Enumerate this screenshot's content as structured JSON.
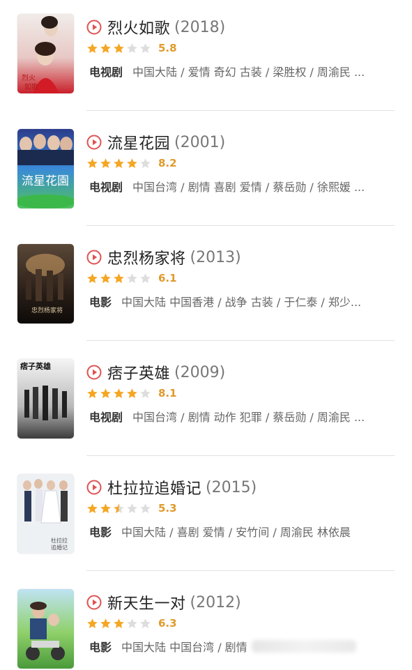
{
  "items": [
    {
      "title": "烈火如歌",
      "year": "(2018)",
      "rating": 5.8,
      "rating_text": "5.8",
      "type": "电视剧",
      "info": "中国大陆 / 爱情 奇幻 古装 / 梁胜权 / 周渝民 ..."
    },
    {
      "title": "流星花园",
      "year": "(2001)",
      "rating": 8.2,
      "rating_text": "8.2",
      "type": "电视剧",
      "info": "中国台湾 / 剧情 喜剧 爱情 / 蔡岳勋 / 徐熙媛 ..."
    },
    {
      "title": "忠烈杨家将",
      "year": "(2013)",
      "rating": 6.1,
      "rating_text": "6.1",
      "type": "电影",
      "info": "中国大陆 中国香港 / 战争 古装 / 于仁泰 / 郑少..."
    },
    {
      "title": "痞子英雄",
      "year": "(2009)",
      "rating": 8.1,
      "rating_text": "8.1",
      "type": "电视剧",
      "info": "中国台湾 / 剧情 动作 犯罪 / 蔡岳勋 / 周渝民 ..."
    },
    {
      "title": "杜拉拉追婚记",
      "year": "(2015)",
      "rating": 5.3,
      "rating_text": "5.3",
      "type": "电影",
      "info": "中国大陆 / 喜剧 爱情 / 安竹间 / 周渝民 林依晨"
    },
    {
      "title": "新天生一对",
      "year": "(2012)",
      "rating": 6.3,
      "rating_text": "6.3",
      "type": "电影",
      "info": "中国大陆 中国台湾 / 剧情"
    }
  ],
  "colors": {
    "play": "#e05252",
    "star_on": "#f5a623",
    "star_off": "#dddddd",
    "score": "#e09a2c"
  },
  "icons": {
    "play": "play-circle-icon",
    "star": "star-icon"
  }
}
